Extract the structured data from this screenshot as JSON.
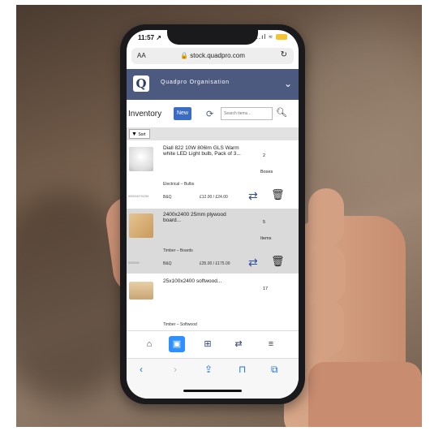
{
  "status": {
    "time": "11:57 ↗",
    "signal": "..ıl ≈"
  },
  "browser": {
    "aa": "AA",
    "url": "stock.quadpro.com"
  },
  "app": {
    "logo": "Q",
    "org_name": "Quadpro Organisation"
  },
  "toolbar": {
    "title": "Inventory",
    "new_label": "New",
    "search_placeholder": "Search items..."
  },
  "sort": {
    "label": "Sort"
  },
  "items": [
    {
      "desc": "Diall 822 10W 806lm GLS Warm white LED Light bulb, Pack of 3...",
      "qty": "2",
      "unit": "Boxes",
      "category": "Electrical – Bulbs",
      "code": "5059340791255",
      "location": "B&Q",
      "price": "£12.00 / £24.00"
    },
    {
      "desc": "2400x2400 25mm plywood board...",
      "qty": "5",
      "unit": "Items",
      "category": "Timber – Boards",
      "code": "5059340",
      "location": "B&Q",
      "price": "£35.00 / £175.00"
    },
    {
      "desc": "25x100x2400 softwood...",
      "qty": "17",
      "unit": "",
      "category": "Timber – Softwood",
      "code": "",
      "location": "",
      "price": ""
    }
  ],
  "colors": {
    "app_bar": "#4d5a80",
    "accent": "#2e90ff",
    "transfer": "#2e4d9f"
  }
}
